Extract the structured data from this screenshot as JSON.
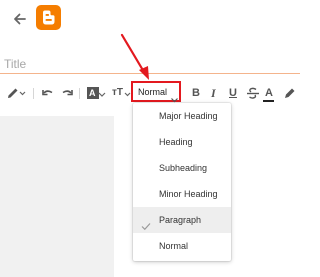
{
  "header": {
    "back_icon": "arrow-back-icon",
    "logo_icon": "blogger-logo-icon"
  },
  "title_field": {
    "placeholder": "Title",
    "value": ""
  },
  "toolbar": {
    "icons": [
      "pencil-icon",
      "undo-icon",
      "redo-icon",
      "text-style-icon",
      "font-size-icon",
      "bold-icon",
      "italic-icon",
      "underline-icon",
      "strikethrough-icon",
      "text-color-icon",
      "highlight-icon"
    ],
    "font_size_glyph": "A",
    "text_size_glyph": "тT",
    "format_select": {
      "value": "Normal"
    },
    "bold_glyph": "B",
    "italic_glyph": "I",
    "underline_glyph": "U",
    "text_color_glyph": "A"
  },
  "format_menu": {
    "items": [
      {
        "label": "Major Heading",
        "selected": false
      },
      {
        "label": "Heading",
        "selected": false
      },
      {
        "label": "Subheading",
        "selected": false
      },
      {
        "label": "Minor Heading",
        "selected": false
      },
      {
        "label": "Paragraph",
        "selected": true
      },
      {
        "label": "Normal",
        "selected": false
      }
    ]
  },
  "colors": {
    "accent_orange": "#f57d00",
    "highlight_red": "#e3191f",
    "title_underline": "#f4b48c",
    "selected_row": "#eeeeee",
    "canvas_gray": "#f1f1f1"
  },
  "annotation": {
    "type": "red-arrow",
    "points_to": "format-select"
  }
}
